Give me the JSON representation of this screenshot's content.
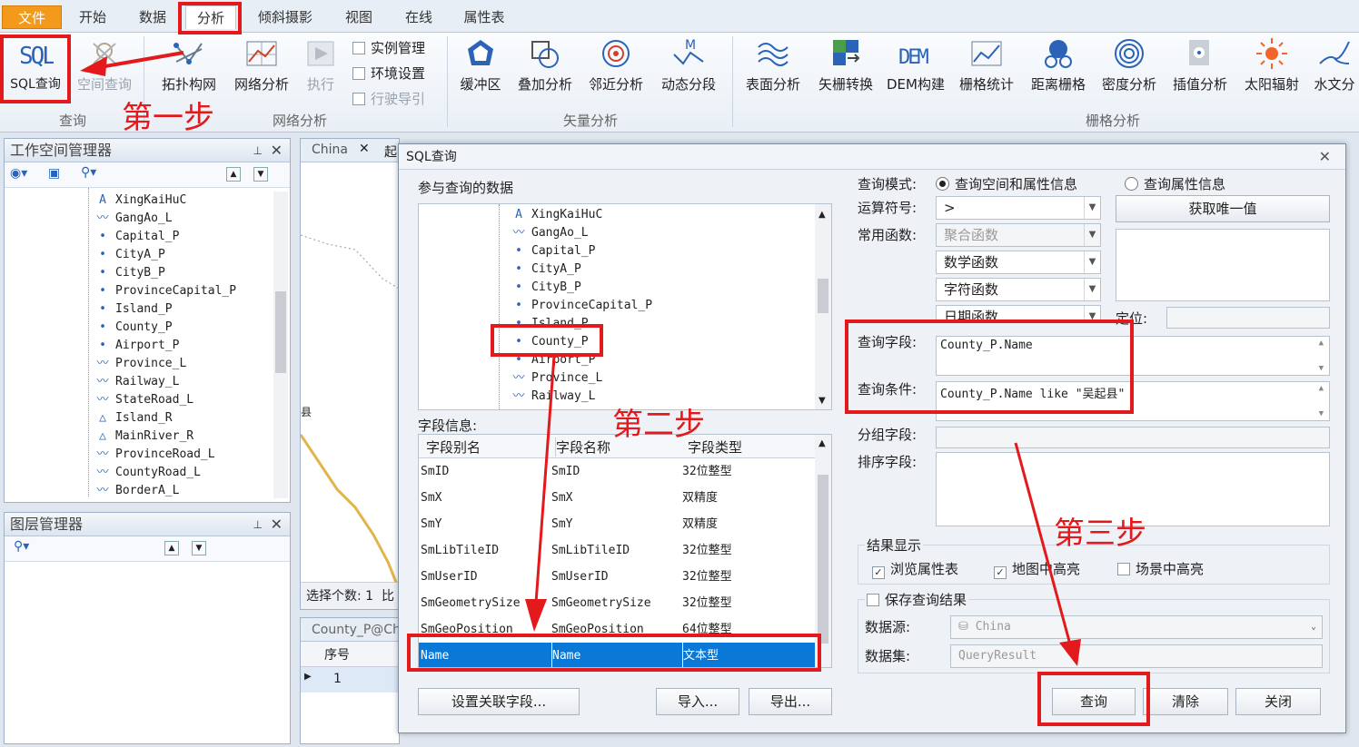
{
  "tabs": [
    "文件",
    "开始",
    "数据",
    "分析",
    "倾斜摄影",
    "视图",
    "在线",
    "属性表"
  ],
  "ribbon": {
    "query_group": {
      "sql": "SQL查询",
      "spatial": "空间查询",
      "label": "查询"
    },
    "network_group": {
      "topo": "拓扑构网",
      "net": "网络分析",
      "exec": "执行",
      "instance": "实例管理",
      "env": "环境设置",
      "guide": "行驶导引",
      "label": "网络分析"
    },
    "vector_group": {
      "buffer": "缓冲区",
      "overlay": "叠加分析",
      "neighbor": "邻近分析",
      "dyn": "动态分段",
      "label": "矢量分析"
    },
    "raster_group": {
      "surface": "表面分析",
      "v2r": "矢栅转换",
      "dem": "DEM构建",
      "stats": "栅格统计",
      "dist": "距离栅格",
      "density": "密度分析",
      "interp": "插值分析",
      "solar": "太阳辐射",
      "hydro": "水文分",
      "label": "栅格分析"
    }
  },
  "workspace": {
    "title": "工作空间管理器",
    "layers": [
      "XingKaiHuC",
      "GangAo_L",
      "Capital_P",
      "CityA_P",
      "CityB_P",
      "ProvinceCapital_P",
      "Island_P",
      "County_P",
      "Airport_P",
      "Province_L",
      "Railway_L",
      "StateRoad_L",
      "Island_R",
      "MainRiver_R",
      "ProvinceRoad_L",
      "CountyRoad_L",
      "BorderA_L"
    ]
  },
  "layer_manager": {
    "title": "图层管理器"
  },
  "map": {
    "tab1": "China",
    "tab2": "起",
    "status": "选择个数: 1",
    "status2": "比",
    "label_county": "县"
  },
  "attr_table": {
    "tab": "County_P@Chi",
    "col_no": "序号",
    "row1": "1"
  },
  "dialog": {
    "title": "SQL查询",
    "data_label": "参与查询的数据",
    "tree": [
      "XingKaiHuC",
      "GangAo_L",
      "Capital_P",
      "CityA_P",
      "CityB_P",
      "ProvinceCapital_P",
      "Island_P",
      "County_P",
      "Airport_P",
      "Province_L",
      "Railway_L"
    ],
    "field_info_label": "字段信息:",
    "field_headers": [
      "字段别名",
      "字段名称",
      "字段类型"
    ],
    "fields": [
      [
        "SmID",
        "SmID",
        "32位整型"
      ],
      [
        "SmX",
        "SmX",
        "双精度"
      ],
      [
        "SmY",
        "SmY",
        "双精度"
      ],
      [
        "SmLibTileID",
        "SmLibTileID",
        "32位整型"
      ],
      [
        "SmUserID",
        "SmUserID",
        "32位整型"
      ],
      [
        "SmGeometrySize",
        "SmGeometrySize",
        "32位整型"
      ],
      [
        "SmGeoPosition",
        "SmGeoPosition",
        "64位整型"
      ],
      [
        "Name",
        "Name",
        "文本型"
      ]
    ],
    "query_mode_label": "查询模式:",
    "mode_spatial": "查询空间和属性信息",
    "mode_attr": "查询属性信息",
    "operator_label": "运算符号:",
    "operator_value": ">",
    "unique_btn": "获取唯一值",
    "func_label": "常用函数:",
    "funcs": [
      "聚合函数",
      "数学函数",
      "字符函数",
      "日期函数"
    ],
    "locate_label": "定位:",
    "query_field_label": "查询字段:",
    "query_field_value": "County_P.Name",
    "condition_label": "查询条件:",
    "condition_value": "County_P.Name like \"吴起县\"",
    "group_label": "分组字段:",
    "sort_label": "排序字段:",
    "result_label": "结果显示",
    "opt_browse": "浏览属性表",
    "opt_map": "地图中高亮",
    "opt_scene": "场景中高亮",
    "save_label": "保存查询结果",
    "datasource_label": "数据源:",
    "datasource_value": "China",
    "dataset_label": "数据集:",
    "dataset_value": "QueryResult",
    "btn_link": "设置关联字段...",
    "btn_import": "导入...",
    "btn_export": "导出...",
    "btn_query": "查询",
    "btn_clear": "清除",
    "btn_close": "关闭"
  },
  "annotations": {
    "step1": "第一步",
    "step2": "第二步",
    "step3": "第三步"
  },
  "colors": {
    "accent_red": "#e3191b",
    "selection": "#0a78d7",
    "file_tab": "#f39a1c"
  }
}
